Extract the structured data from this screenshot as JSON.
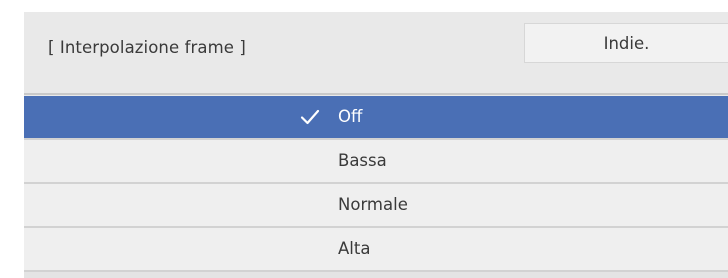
{
  "header": {
    "title": "[ Interpolazione frame ]",
    "back_label": "Indie."
  },
  "options": [
    {
      "label": "Off",
      "selected": true
    },
    {
      "label": "Bassa",
      "selected": false
    },
    {
      "label": "Normale",
      "selected": false
    },
    {
      "label": "Alta",
      "selected": false
    }
  ],
  "colors": {
    "selected_bg": "#4a6fb5",
    "panel_bg": "#e9e9e9",
    "option_bg": "#efefef"
  }
}
